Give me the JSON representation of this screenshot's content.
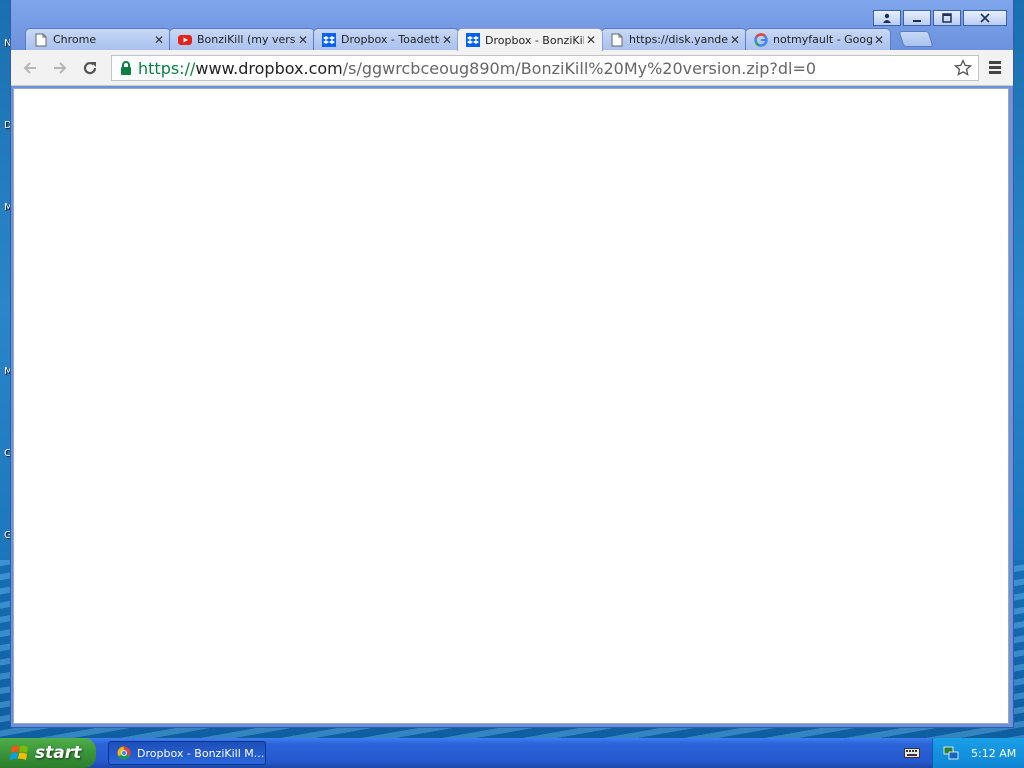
{
  "desktop": {
    "edge_letters": [
      "N",
      "D",
      "M",
      "M",
      "C",
      "G"
    ]
  },
  "browser": {
    "tabs": [
      {
        "label": "Chrome",
        "icon": "page-icon",
        "active": false
      },
      {
        "label": "BonziKill (my versio",
        "icon": "youtube-icon",
        "active": false
      },
      {
        "label": "Dropbox - Toadette",
        "icon": "dropbox-icon",
        "active": false
      },
      {
        "label": "Dropbox - BonziKill",
        "icon": "dropbox-icon",
        "active": true
      },
      {
        "label": "https://disk.yande",
        "icon": "page-icon",
        "active": false
      },
      {
        "label": "notmyfault - Goog",
        "icon": "google-icon",
        "active": false
      }
    ],
    "window_controls": {
      "user": "user-icon",
      "minimize": "minimize-icon",
      "maximize": "maximize-icon",
      "close": "close-icon"
    },
    "omnibox": {
      "scheme": "https://",
      "host": "www.dropbox.com",
      "path": "/s/ggwrcbceoug890m/BonziKill%20My%20version.zip?dl=0"
    },
    "colors": {
      "secure_scheme": "#0b8043",
      "youtube": "#e62117",
      "dropbox": "#0061fe"
    }
  },
  "taskbar": {
    "start_label": "start",
    "task_label": "Dropbox - BonziKill M...",
    "clock": "5:12 AM"
  }
}
